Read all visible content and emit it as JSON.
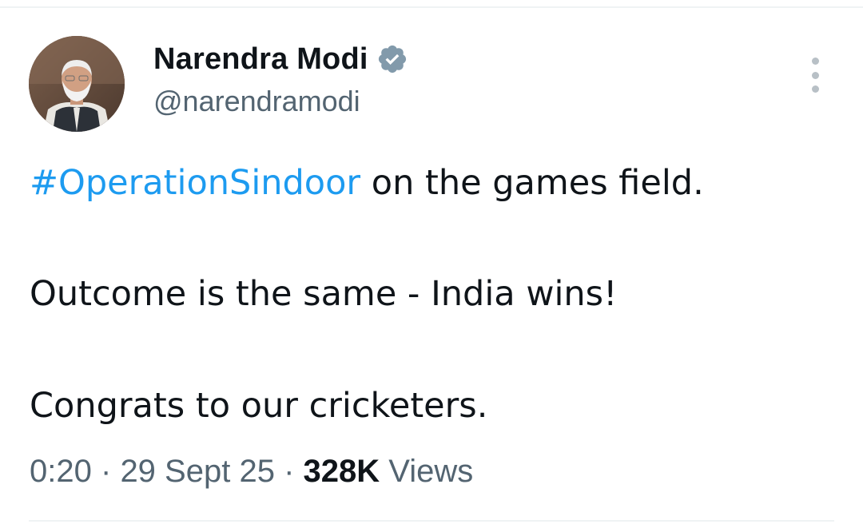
{
  "author": {
    "display_name": "Narendra Modi",
    "handle": "@narendramodi",
    "verified_icon": "verified-badge-icon",
    "verified_color": "#829aab"
  },
  "tweet": {
    "hashtag": "#OperationSindoor",
    "line1_rest": " on the games field.",
    "line2": "Outcome is the same - India wins!",
    "line3": "Congrats to our cricketers."
  },
  "meta": {
    "time": "0:20",
    "separator": "·",
    "date": "29 Sept 25",
    "views_count": "328K",
    "views_label": "Views"
  },
  "colors": {
    "text_primary": "#0f1419",
    "text_secondary": "#536471",
    "link": "#1d9bf0",
    "divider": "#eff3f4"
  },
  "icons": {
    "more": "more-vertical-icon"
  }
}
